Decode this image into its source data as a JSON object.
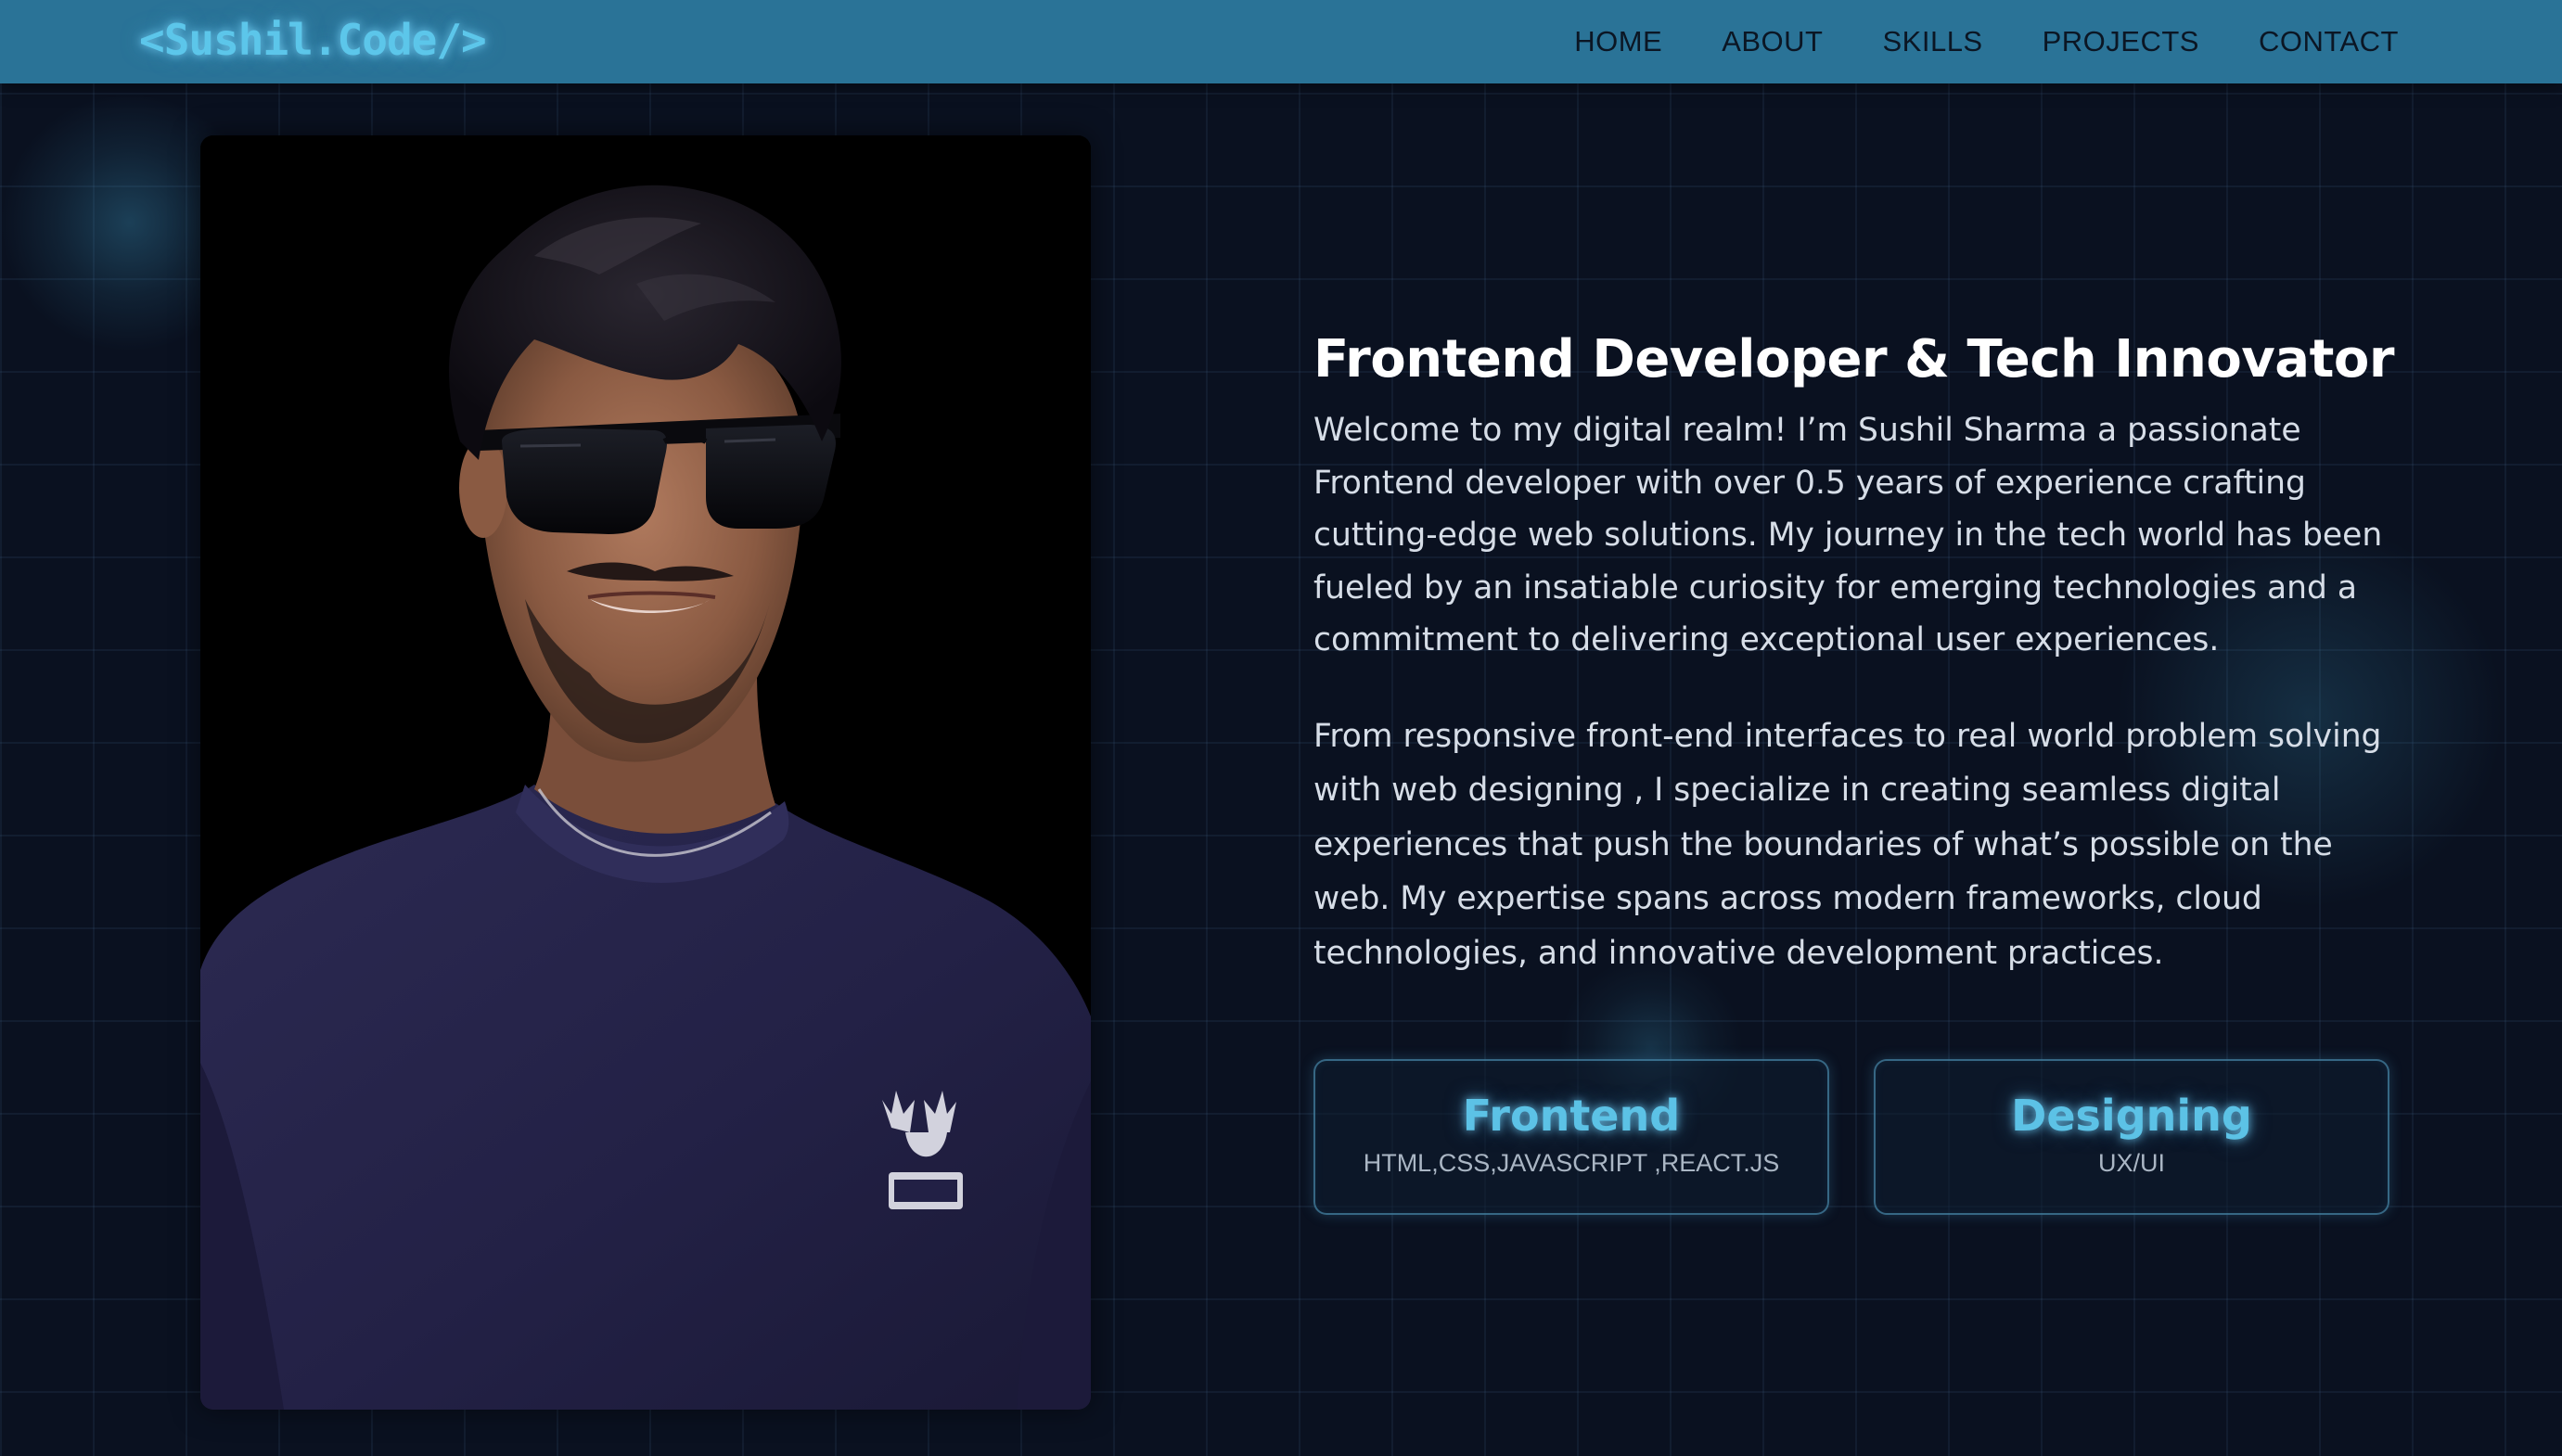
{
  "colors": {
    "navbar_bg": "#2a7397",
    "page_bg": "#0a1120",
    "accent": "#5cc2e6",
    "heading": "#ffffff",
    "body_text": "#d6dde7"
  },
  "navbar": {
    "logo": "<Sushil.Code/>",
    "links": [
      "HOME",
      "ABOUT",
      "SKILLS",
      "PROJECTS",
      "CONTACT"
    ]
  },
  "hero": {
    "photo_icon": "portrait-photo",
    "headline": "Frontend Developer & Tech Innovator",
    "paragraph_1": "Welcome to my digital realm! I’m Sushil Sharma a passionate Frontend developer with over 0.5 years of experience crafting cutting-edge web solutions. My journey in the tech world has been fueled by an insatiable curiosity for emerging technologies and a commitment to delivering exceptional user experiences.",
    "paragraph_2": "From responsive front-end interfaces to real world problem solving with web designing , I specialize in creating seamless digital experiences that push the boundaries of what’s possible on the web. My expertise spans across modern frameworks, cloud technologies, and innovative development practices."
  },
  "skills": [
    {
      "title": "Frontend",
      "subtitle": "HTML,CSS,JAVASCRIPT ,REACT.JS"
    },
    {
      "title": "Designing",
      "subtitle": "UX/UI"
    }
  ]
}
